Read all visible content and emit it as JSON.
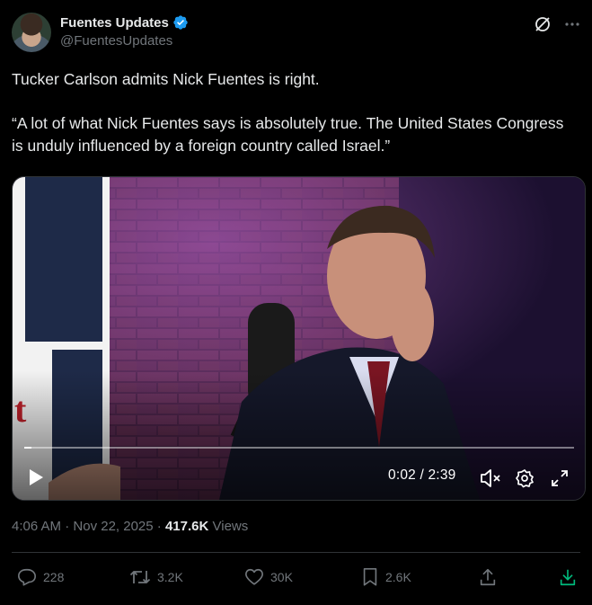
{
  "author": {
    "display_name": "Fuentes Updates",
    "handle": "@FuentesUpdates",
    "verified": true
  },
  "header_icons": [
    "grok-icon",
    "more-icon"
  ],
  "tweet": {
    "line1": "Tucker Carlson admits Nick Fuentes is right.",
    "line2": "“A lot of what Nick Fuentes says is absolutely true. The United States Congress is unduly influenced by a foreign country called Israel.”"
  },
  "video": {
    "time_display": "0:02 / 2:39",
    "progress": 0.013,
    "muted": true,
    "icons": [
      "play-icon",
      "mute-icon",
      "settings-icon",
      "fullscreen-icon"
    ]
  },
  "meta": {
    "time": "4:06 AM",
    "sep": "·",
    "date": "Nov 22, 2025",
    "views_count": "417.6K",
    "views_label": "Views"
  },
  "actions": {
    "replies": "228",
    "reposts": "3.2K",
    "likes": "30K",
    "bookmarks": "2.6K"
  },
  "colors": {
    "background": "#000000",
    "text": "#e7e9ea",
    "secondary": "#71767b",
    "verified": "#1d9bf0",
    "download_accent": "#00ba7c"
  }
}
